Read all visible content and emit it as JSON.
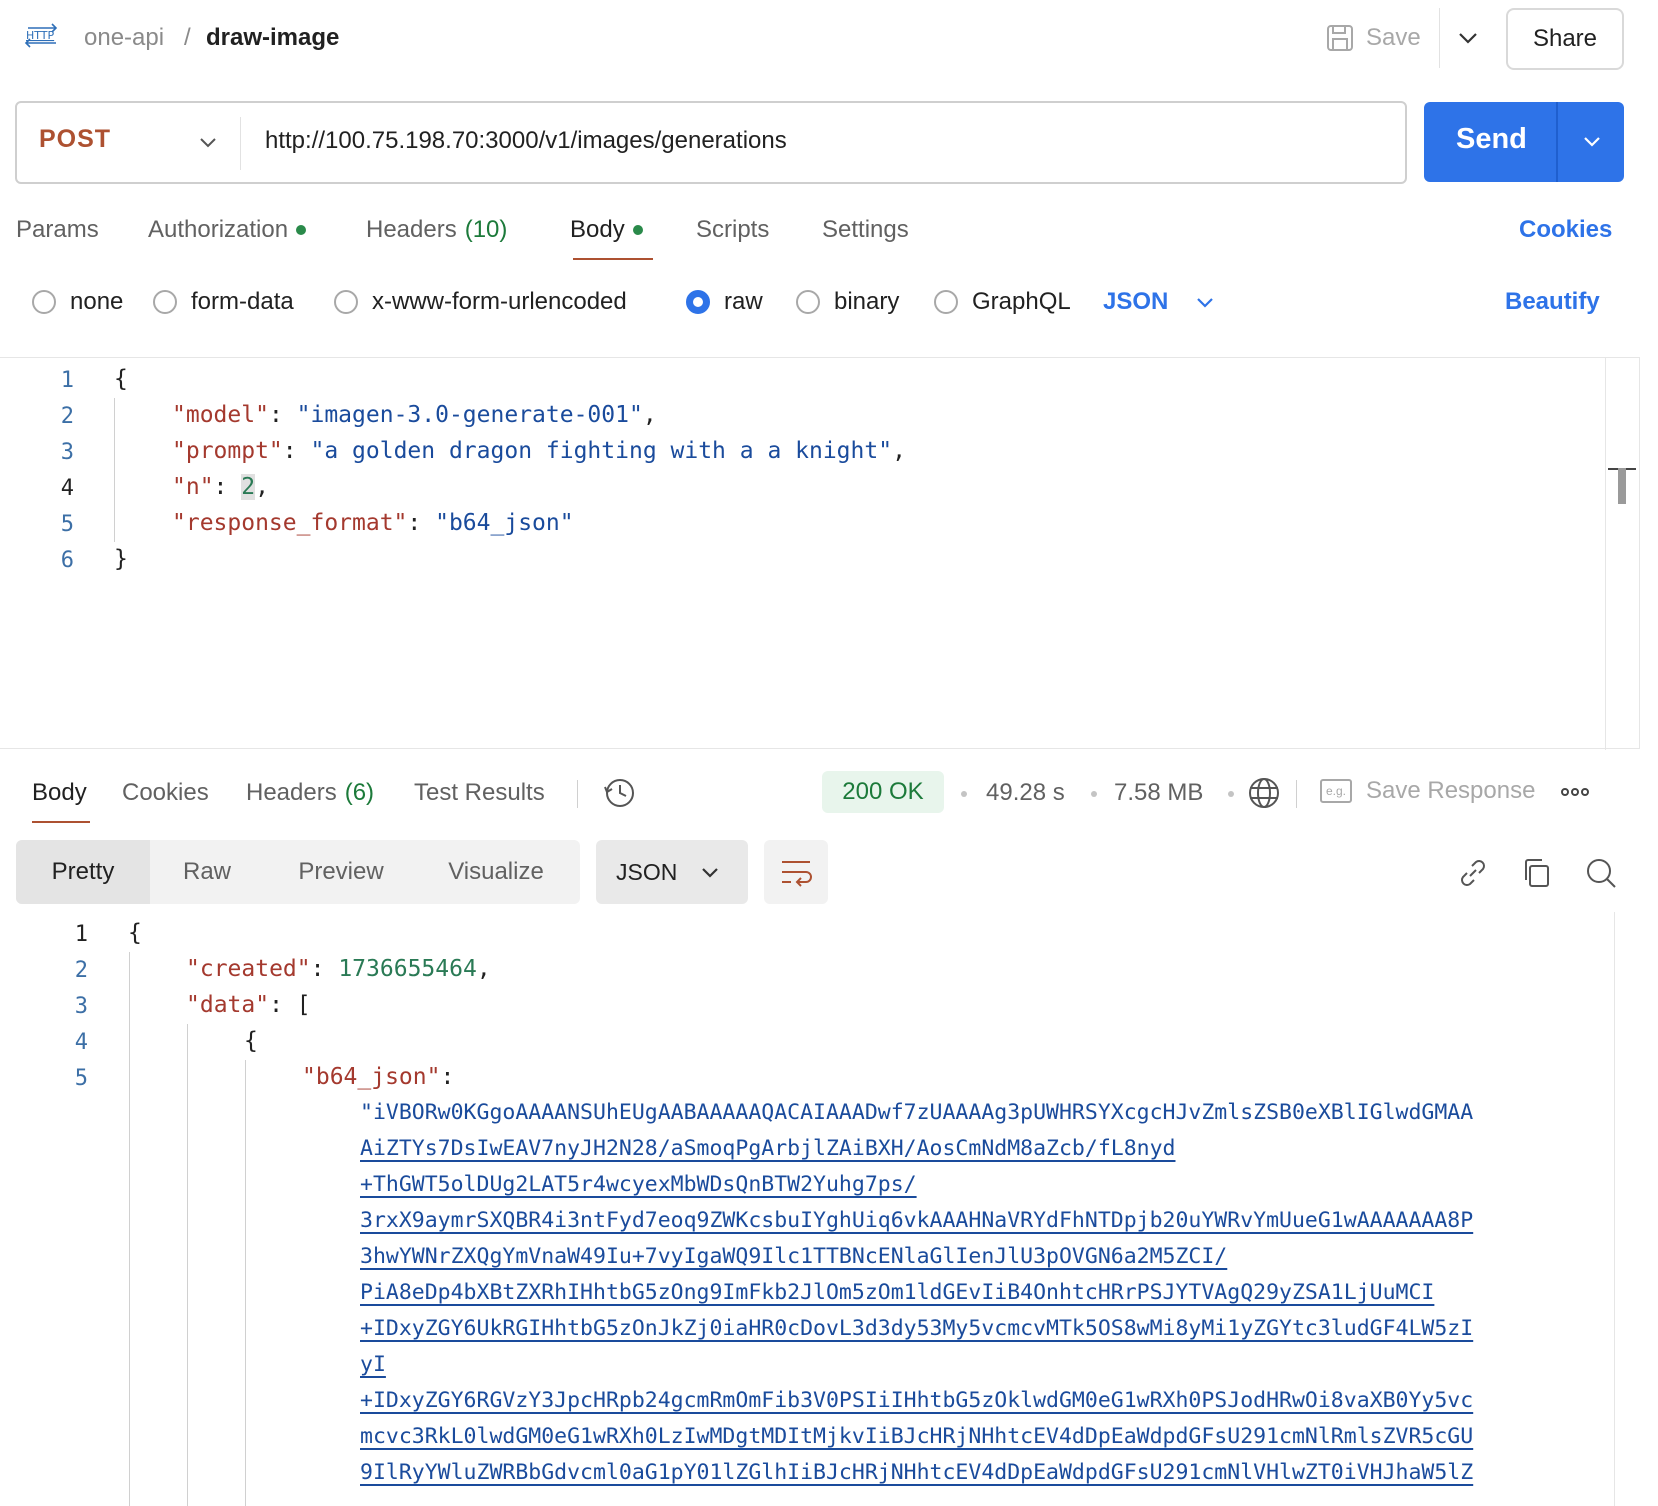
{
  "header": {
    "breadcrumb_parent": "one-api",
    "breadcrumb_separator": "/",
    "breadcrumb_current": "draw-image",
    "save_label": "Save",
    "share_label": "Share"
  },
  "request": {
    "method": "POST",
    "url": "http://100.75.198.70:3000/v1/images/generations",
    "send_label": "Send",
    "tabs": [
      {
        "label": "Params"
      },
      {
        "label": "Authorization"
      },
      {
        "label": "Headers",
        "count": "(10)"
      },
      {
        "label": "Body"
      },
      {
        "label": "Scripts"
      },
      {
        "label": "Settings"
      }
    ],
    "cookies_label": "Cookies",
    "body_types": [
      "none",
      "form-data",
      "x-www-form-urlencoded",
      "raw",
      "binary",
      "GraphQL"
    ],
    "selected_body_type": "raw",
    "language": "JSON",
    "beautify_label": "Beautify",
    "body_lines": [
      "1",
      "2",
      "3",
      "4",
      "5",
      "6"
    ],
    "body": {
      "model_key": "\"model\"",
      "model_value": "\"imagen-3.0-generate-001\"",
      "prompt_key": "\"prompt\"",
      "prompt_value": "\"a golden dragon fighting with a a knight\"",
      "n_key": "\"n\"",
      "n_value": "2",
      "format_key": "\"response_format\"",
      "format_value": "\"b64_json\""
    }
  },
  "response": {
    "tabs": [
      {
        "label": "Body"
      },
      {
        "label": "Cookies"
      },
      {
        "label": "Headers",
        "count": "(6)"
      },
      {
        "label": "Test Results"
      }
    ],
    "status": "200 OK",
    "time": "49.28 s",
    "size": "7.58 MB",
    "save_response_label": "Save Response",
    "eg_label": "e.g.",
    "view_modes": [
      "Pretty",
      "Raw",
      "Preview",
      "Visualize"
    ],
    "format": "JSON",
    "line_numbers": [
      "1",
      "2",
      "3",
      "4",
      "5"
    ],
    "created_key": "\"created\"",
    "created_value": "1736655464",
    "data_key": "\"data\"",
    "b64_key": "\"b64_json\"",
    "b64_lines": [
      "\"iVBORw0KGgoAAAANSUhEUgAABAAAAAQACAIAAADwf7zUAAAAg3pUWHRSYXcgcHJvZmlsZSB0eXBlIGlwdGMAA",
      "AiZTYs7DsIwEAV7nyJH2N28/aSmoqPgArbjlZAiBXH/AosCmNdM8aZcb/fL8nyd",
      "+ThGWT5olDUg2LAT5r4wcyexMbWDsQnBTW2Yuhg7ps/",
      "3rxX9aymrSXQBR4i3ntFyd7eoq9ZWKcsbuIYghUiq6vkAAAHNaVRYdFhNTDpjb20uYWRvYmUueG1wAAAAAAA8P",
      "3hwYWNrZXQgYmVnaW49Iu+7vyIgaWQ9Ilc1TTBNcENlaGlIenJlU3pOVGN6a2M5ZCI/",
      "PiA8eDp4bXBtZXRhIHhtbG5zOng9ImFkb2JlOm5zOm1ldGEvIiB4OnhtcHRrPSJYTVAgQ29yZSA1LjUuMCI",
      "+IDxyZGY6UkRGIHhtbG5zOnJkZj0iaHR0cDovL3d3dy53My5vcmcvMTk5OS8wMi8yMi1yZGYtc3ludGF4LW5zI",
      "yI",
      "+IDxyZGY6RGVzY3JpcHRpb24gcmRmOmFib3V0PSIiIHhtbG5zOklwdGM0eG1wRXh0PSJodHRwOi8vaXB0Yy5vc",
      "mcvc3RkL0lwdGM0eG1wRXh0LzIwMDgtMDItMjkvIiBJcHRjNHhtcEV4dDpEaWdpdGFsU291cmNlRmlsZVR5cGU",
      "9IlRyYWluZWRBbGdvcml0aG1pY01lZGlhIiBJcHRjNHhtcEV4dDpEaWdpdGFsU291cmNlVHlwZT0iVHJhaW5lZ"
    ]
  }
}
